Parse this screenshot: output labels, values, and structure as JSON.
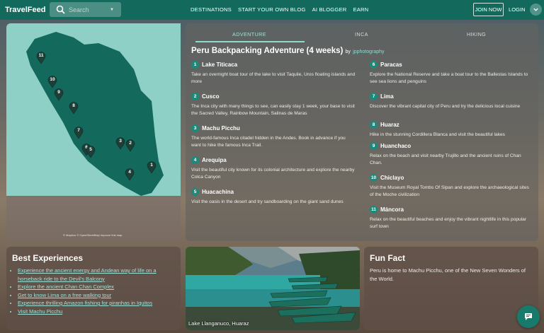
{
  "header": {
    "logo": "TravelFeed",
    "search_placeholder": "Search",
    "nav": [
      "DESTINATIONS",
      "START YOUR OWN BLOG",
      "AI BLOGGER",
      "EARN"
    ],
    "join": "JOIN NOW",
    "login": "LOGIN"
  },
  "map": {
    "attribution": "© Mapbox © OpenStreetMap Improve this map",
    "markers": [
      "11",
      "10",
      "9",
      "8",
      "7",
      "6",
      "5",
      "3",
      "2",
      "4",
      "1"
    ]
  },
  "tabs": [
    "ADVENTURE",
    "INCA",
    "HIKING"
  ],
  "trip": {
    "title": "Peru Backpacking Adventure (4 weeks)",
    "by": "by",
    "author": "jpphotography"
  },
  "stops": [
    {
      "num": "1",
      "name": "Lake Titicaca",
      "desc": "Take an overnight boat tour of the lake to visit Taquile, Uros floating islands and more"
    },
    {
      "num": "2",
      "name": "Cusco",
      "desc": "The Inca city with many things to see, can easily stay 1 week, your base to visit the Sacred Valley, Rainbow Mountain, Salinas de Maras"
    },
    {
      "num": "3",
      "name": "Machu Picchu",
      "desc": "The world-famous Inca citadel hidden in the Andes. Book in advance if you want to hike the famous Inca Trail."
    },
    {
      "num": "4",
      "name": "Arequipa",
      "desc": "Visit the beautiful city known for its colonial architecture and explore the nearby Colca Canyon"
    },
    {
      "num": "5",
      "name": "Huacachina",
      "desc": "Visit the oasis in the desert and try sandboarding on the giant sand dunes"
    },
    {
      "num": "6",
      "name": "Paracas",
      "desc": "Explore the National Reserve and take a boat tour to the Ballestas Islands to see sea lions and penguins"
    },
    {
      "num": "7",
      "name": "Lima",
      "desc": "Discover the vibrant capital city of Peru and try the delicious local cuisine"
    },
    {
      "num": "8",
      "name": "Huaraz",
      "desc": "Hike in the stunning Cordillera Blanca and visit the beautiful lakes"
    },
    {
      "num": "9",
      "name": "Huanchaco",
      "desc": "Relax on the beach and visit nearby Trujillo and the ancient ruins of Chan Chan."
    },
    {
      "num": "10",
      "name": "Chiclayo",
      "desc": "Visit the Museum Royal Tombs Of Sipan and explore the archaeological sites of the Moche civilization"
    },
    {
      "num": "11",
      "name": "Máncora",
      "desc": "Relax on the beautiful beaches and enjoy the vibrant nightlife in this popular surf town"
    }
  ],
  "best": {
    "title": "Best Experiences",
    "items": [
      "Experience the ancient energy and Andean way of life on a horseback ride to the Devil's Balcony",
      "Explore the ancient Chan Chan Complex",
      "Get to know Lima on a free walking tour",
      "Experience thrilling Amazon fishing for piranhas in Iquitos",
      "Visit Machu Picchu"
    ]
  },
  "photo": {
    "caption": "Lake Llanganuco, Huaraz"
  },
  "fact": {
    "title": "Fun Fact",
    "text": "Peru is home to Machu Picchu, one of the New Seven Wonders of the World."
  },
  "colors": {
    "brand": "#136a5c",
    "accent": "#8fd9cd",
    "map_water": "#8ecfc6",
    "map_land": "#136a5c"
  },
  "icons": [
    "search-icon",
    "chevron-down-icon",
    "map-pin-icon",
    "chat-icon"
  ]
}
